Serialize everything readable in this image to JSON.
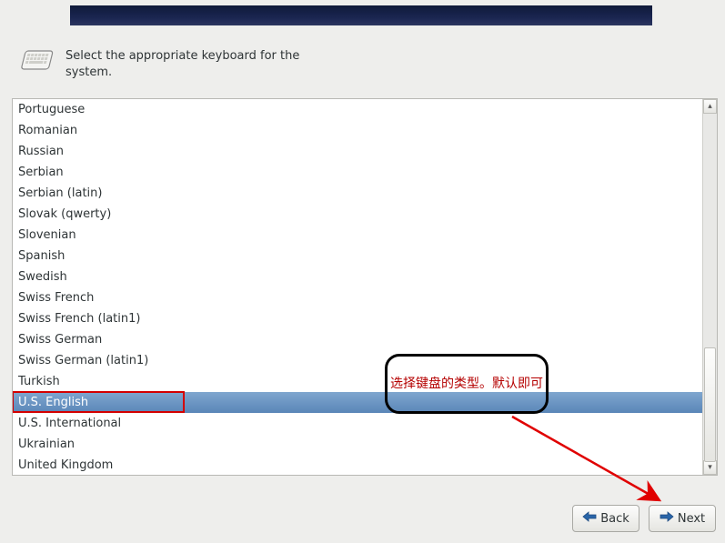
{
  "prompt_text": "Select the appropriate keyboard for the system.",
  "keyboard_layouts": [
    "Portuguese",
    "Romanian",
    "Russian",
    "Serbian",
    "Serbian (latin)",
    "Slovak (qwerty)",
    "Slovenian",
    "Spanish",
    "Swedish",
    "Swiss French",
    "Swiss French (latin1)",
    "Swiss German",
    "Swiss German (latin1)",
    "Turkish",
    "U.S. English",
    "U.S. International",
    "Ukrainian",
    "United Kingdom"
  ],
  "selected_index": 14,
  "buttons": {
    "back": "Back",
    "next": "Next"
  },
  "annotation": {
    "callout_text": "选择键盘的类型。默认即可"
  },
  "scrollbar": {
    "thumb_top_fraction": 0.67,
    "thumb_height_fraction": 0.33
  }
}
